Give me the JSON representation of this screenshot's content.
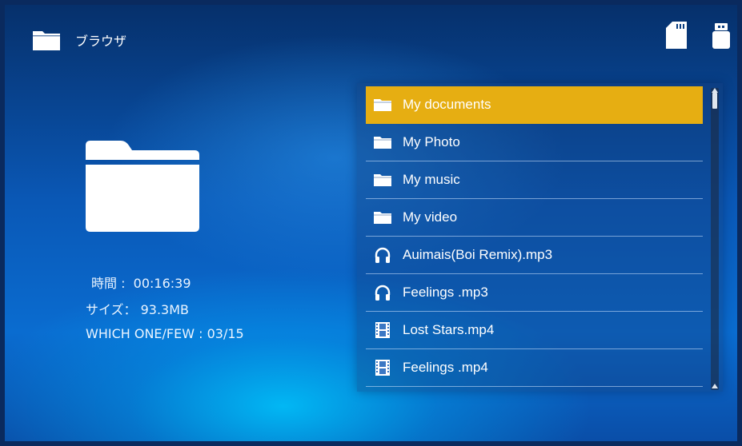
{
  "header": {
    "title": "ブラウザ",
    "icons": [
      "folder-icon",
      "sd-card-icon",
      "usb-drive-icon"
    ]
  },
  "info": {
    "time": "時間 :  00:16:39",
    "size": "サイズ： 93.3MB",
    "index": "WHICH ONE/FEW : 03/15"
  },
  "file_list": [
    {
      "label": "My documents",
      "icon": "folder-icon",
      "selected": true
    },
    {
      "label": "My Photo",
      "icon": "folder-icon",
      "selected": false
    },
    {
      "label": "My music",
      "icon": "folder-icon",
      "selected": false
    },
    {
      "label": "My video",
      "icon": "folder-icon",
      "selected": false
    },
    {
      "label": "Auimais(Boi Remix).mp3",
      "icon": "headphones-icon",
      "selected": false
    },
    {
      "label": "Feelings .mp3",
      "icon": "headphones-icon",
      "selected": false
    },
    {
      "label": "Lost Stars.mp4",
      "icon": "film-icon",
      "selected": false
    },
    {
      "label": "Feelings .mp4",
      "icon": "film-icon",
      "selected": false
    }
  ],
  "colors": {
    "selection": "#e6ae12",
    "text": "#ffffff"
  }
}
